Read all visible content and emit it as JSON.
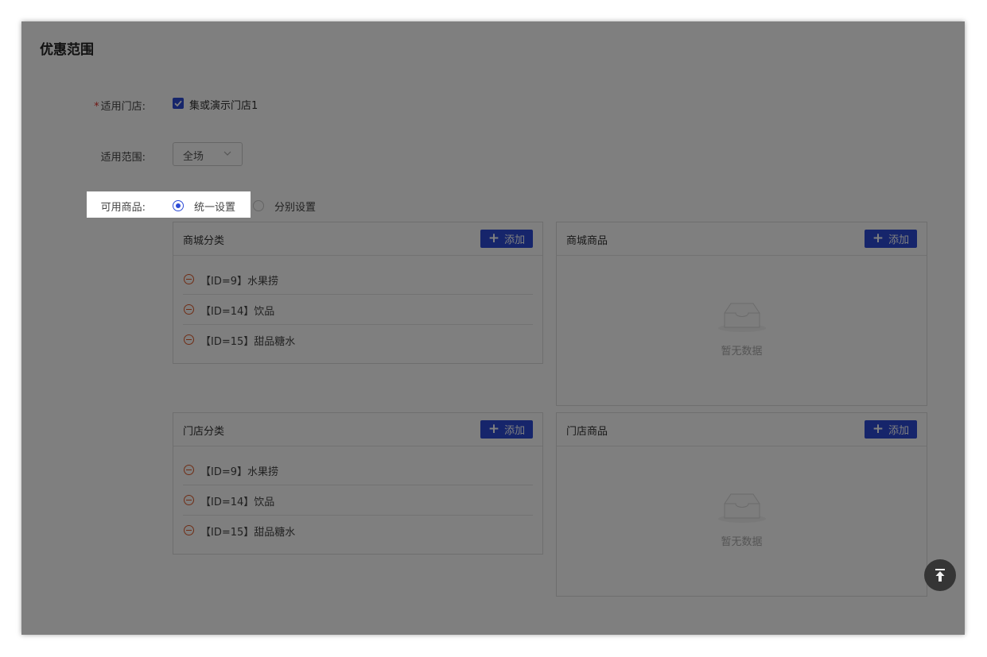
{
  "section": {
    "title": "优惠范围"
  },
  "store": {
    "required_mark": "*",
    "label": "适用门店:",
    "option_label": "集或演示门店1",
    "checked": true
  },
  "scope": {
    "label": "适用范围:",
    "value": "全场"
  },
  "goods": {
    "label": "可用商品:",
    "options": [
      {
        "label": "统一设置",
        "selected": true
      },
      {
        "label": "分别设置",
        "selected": false
      }
    ]
  },
  "mall_category": {
    "title": "商城分类",
    "add_label": "添加",
    "items": [
      {
        "label": "【ID=9】水果捞"
      },
      {
        "label": "【ID=14】饮品"
      },
      {
        "label": "【ID=15】甜品糖水"
      }
    ]
  },
  "mall_goods": {
    "title": "商城商品",
    "add_label": "添加",
    "empty_text": "暂无数据"
  },
  "store_category": {
    "title": "门店分类",
    "add_label": "添加",
    "items": [
      {
        "label": "【ID=9】水果捞"
      },
      {
        "label": "【ID=14】饮品"
      },
      {
        "label": "【ID=15】甜品糖水"
      }
    ]
  },
  "store_goods": {
    "title": "门店商品",
    "add_label": "添加",
    "empty_text": "暂无数据"
  },
  "colors": {
    "accent": "#2d4bd6",
    "remove": "#e05a2a",
    "required": "#e0322a"
  },
  "icons": {
    "back_to_top": "back-to-top-icon",
    "empty": "empty-inbox-icon",
    "remove": "minus-circle-icon"
  }
}
